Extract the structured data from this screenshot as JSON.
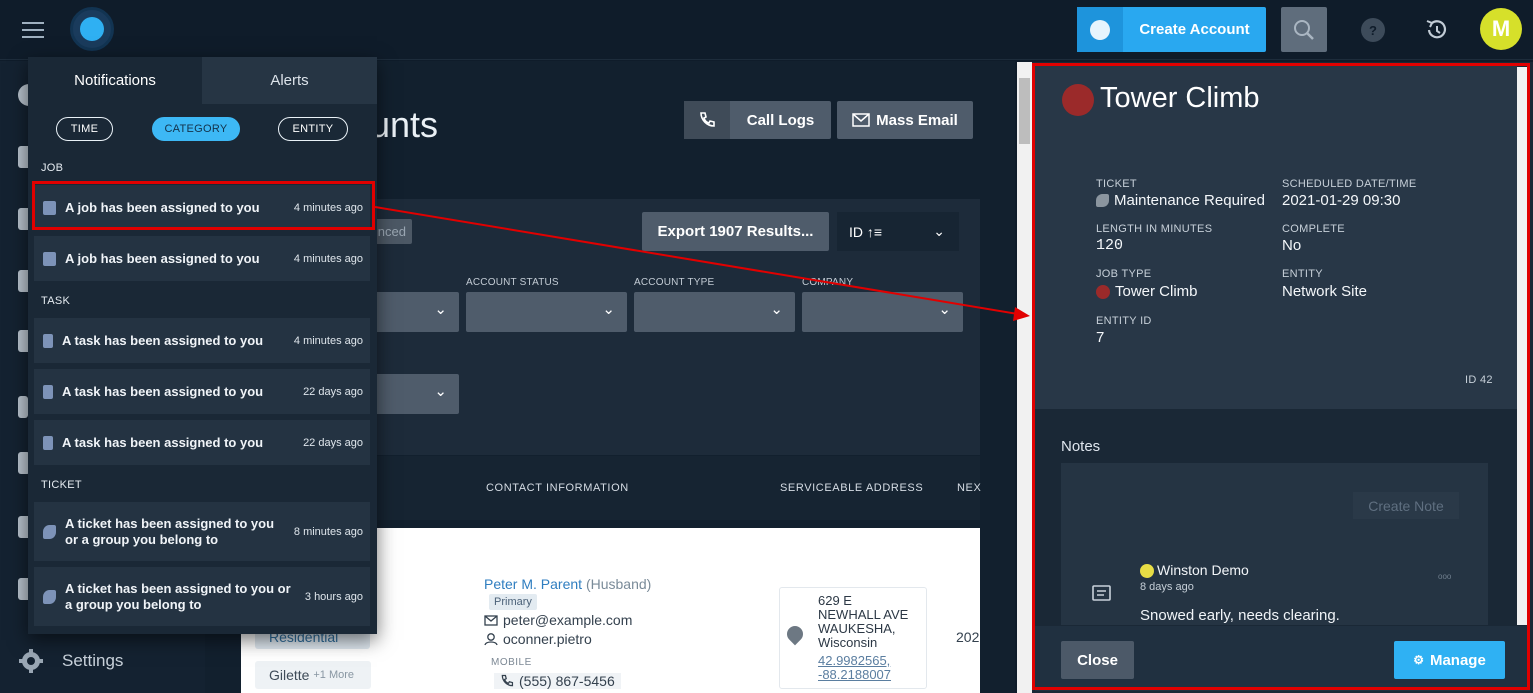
{
  "topbar": {
    "create_account": "Create Account",
    "help": "?",
    "avatar_initial": "M"
  },
  "sidebar": {
    "settings": "Settings"
  },
  "accounts": {
    "title_visible": "unts",
    "call_logs": "Call Logs",
    "mass_email": "Mass Email",
    "advanced": "nced",
    "export": "Export 1907 Results...",
    "sort": "ID ↑≡",
    "filters": {
      "account_status": "ACCOUNT STATUS",
      "account_type": "ACCOUNT TYPE",
      "company": "COMPANY"
    },
    "columns": {
      "contact": "CONTACT INFORMATION",
      "address": "SERVICEABLE ADDRESS",
      "next": "NEX"
    },
    "row": {
      "contact_name": "Peter M. Parent",
      "relation": "(Husband)",
      "primary": "Primary",
      "email": "peter@example.com",
      "username": "oconner.pietro",
      "mobile_label": "MOBILE",
      "phone": "(555) 867-5456",
      "address_line1": "629 E",
      "address_line2": "NEWHALL AVE",
      "address_line3": "WAUKESHA,",
      "address_line4": "Wisconsin",
      "lat": "42.9982565,",
      "lng": "-88.2188007",
      "next_partial": "202",
      "tag_residential": "Residential",
      "tag_gilette": "Gilette",
      "more": "+1 More"
    }
  },
  "notifications": {
    "tab_notifications": "Notifications",
    "tab_alerts": "Alerts",
    "filters": [
      "TIME",
      "CATEGORY",
      "ENTITY"
    ],
    "groups": {
      "job": "JOB",
      "task": "TASK",
      "ticket": "TICKET"
    },
    "items": [
      {
        "text": "A job has been assigned to you",
        "time": "4 minutes ago"
      },
      {
        "text": "A job has been assigned to you",
        "time": "4 minutes ago"
      },
      {
        "text": "A task has been assigned to you",
        "time": "4 minutes ago"
      },
      {
        "text": "A task has been assigned to you",
        "time": "22 days ago"
      },
      {
        "text": "A task has been assigned to you",
        "time": "22 days ago"
      },
      {
        "text": "A ticket has been assigned to you or a group you belong to",
        "time": "8 minutes ago"
      },
      {
        "text": "A ticket has been assigned to you or a group you belong to",
        "time": "3 hours ago"
      }
    ]
  },
  "detail": {
    "title": "Tower Climb",
    "ticket_label": "TICKET",
    "ticket_value": "Maintenance Required",
    "scheduled_label": "SCHEDULED DATE/TIME",
    "scheduled_value": "2021-01-29 09:30",
    "length_label": "LENGTH IN MINUTES",
    "length_value": "120",
    "complete_label": "COMPLETE",
    "complete_value": "No",
    "job_type_label": "JOB TYPE",
    "job_type_value": "Tower Climb",
    "entity_label": "ENTITY",
    "entity_value": "Network Site",
    "entity_id_label": "ENTITY ID",
    "entity_id_value": "7",
    "id": "ID 42",
    "notes_label": "Notes",
    "create_note": "Create Note",
    "note_author": "Winston Demo",
    "note_time": "8 days ago",
    "note_text": "Snowed early, needs clearing.",
    "note_more": "ooo",
    "close": "Close",
    "manage": "Manage"
  },
  "colors": {
    "accent": "#29a8f0",
    "highlight_red": "#e10000",
    "job_type_dot": "#9b2a2a"
  }
}
